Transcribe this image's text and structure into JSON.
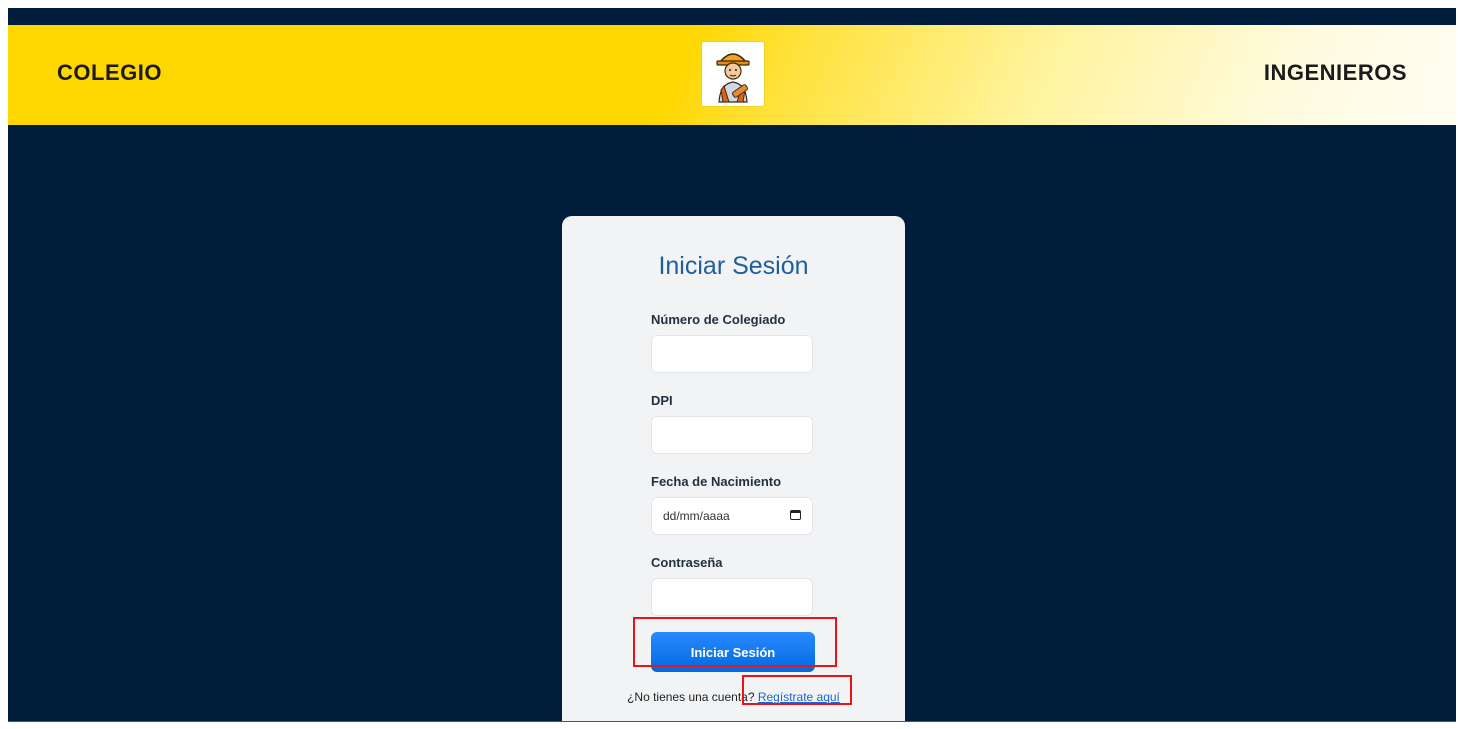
{
  "header": {
    "left_title": "COLEGIO",
    "right_title": "INGENIEROS",
    "logo_icon": "engineer-icon"
  },
  "login": {
    "title": "Iniciar Sesión",
    "fields": [
      {
        "label": "Número de Colegiado",
        "value": ""
      },
      {
        "label": "DPI",
        "value": ""
      },
      {
        "label": "Fecha de Nacimiento",
        "placeholder": "dd/mm/aaaa"
      },
      {
        "label": "Contraseña",
        "value": ""
      }
    ],
    "submit_label": "Iniciar Sesión",
    "register_prompt": "¿No tienes una cuenta?",
    "register_link": "Regístrate aquí"
  },
  "colors": {
    "background": "#001e3c",
    "header_yellow": "#ffd700",
    "primary_button": "#0069e0",
    "annotation_red": "#e8141a"
  }
}
